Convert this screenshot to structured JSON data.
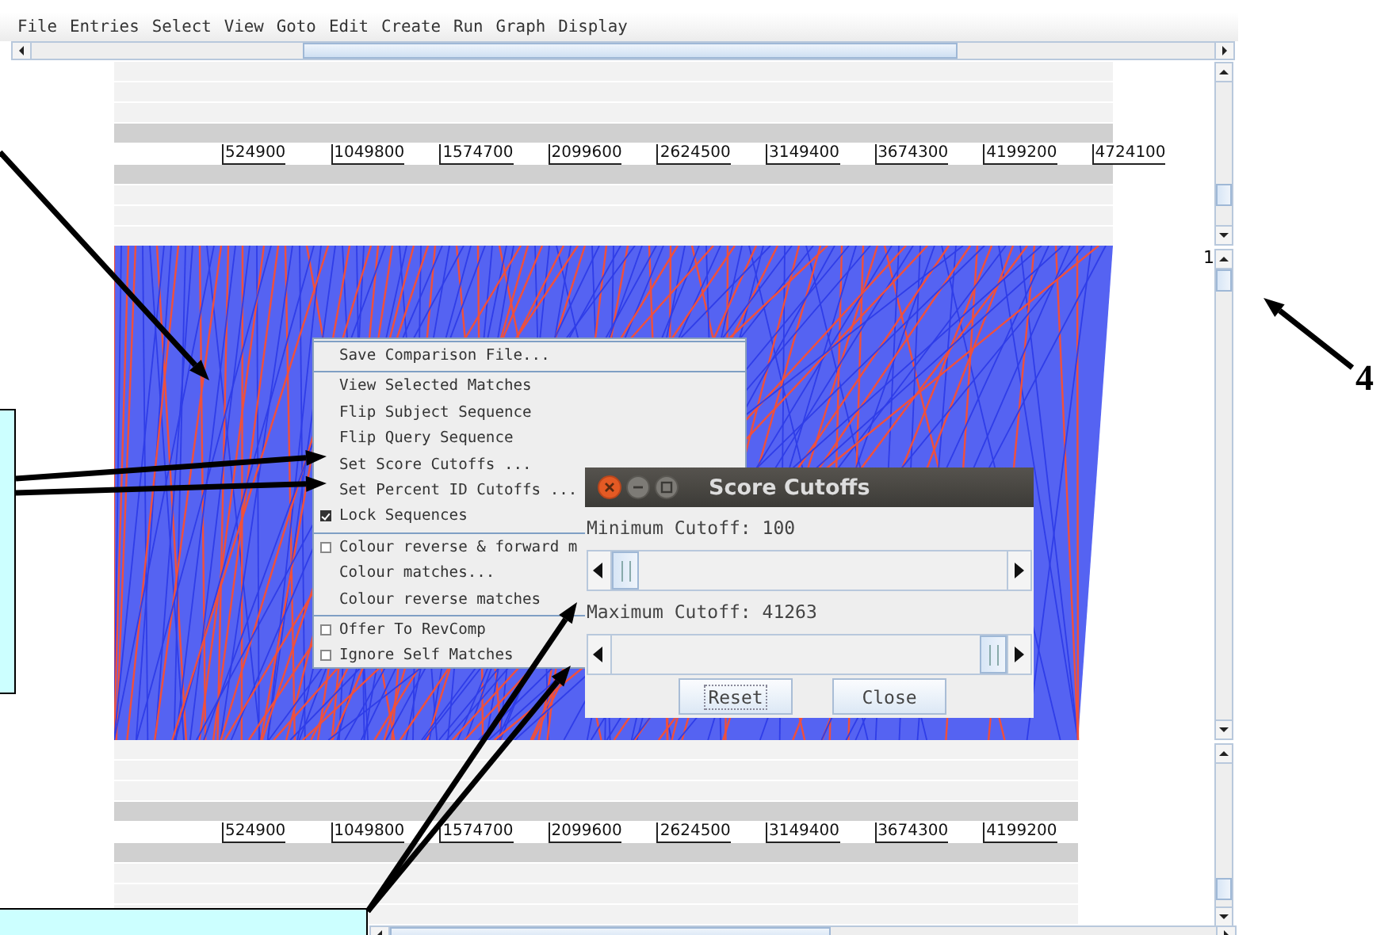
{
  "menubar": {
    "items": [
      "File",
      "Entries",
      "Select",
      "View",
      "Goto",
      "Edit",
      "Create",
      "Run",
      "Graph",
      "Display"
    ]
  },
  "top_ruler": {
    "ticks": [
      "524900",
      "1049800",
      "1574700",
      "2099600",
      "2624500",
      "3149400",
      "3674300",
      "4199200",
      "4724100"
    ]
  },
  "comparison_view": {
    "side_label": "1"
  },
  "bottom_ruler": {
    "ticks": [
      "524900",
      "1049800",
      "1574700",
      "2099600",
      "2624500",
      "3149400",
      "3674300",
      "4199200"
    ]
  },
  "popup_menu": {
    "groups": [
      [
        {
          "kind": "action",
          "label": "Save Comparison File..."
        }
      ],
      [
        {
          "kind": "action",
          "label": "View Selected Matches"
        },
        {
          "kind": "action",
          "label": "Flip Subject Sequence"
        },
        {
          "kind": "action",
          "label": "Flip Query Sequence"
        },
        {
          "kind": "action",
          "label": "Set Score Cutoffs ..."
        },
        {
          "kind": "action",
          "label": "Set Percent ID Cutoffs ..."
        },
        {
          "kind": "checkbox",
          "label": "Lock Sequences",
          "checked": true
        }
      ],
      [
        {
          "kind": "checkbox",
          "label": "Colour reverse & forward m",
          "checked": false
        },
        {
          "kind": "action",
          "label": "Colour matches..."
        },
        {
          "kind": "action",
          "label": "Colour reverse matches"
        }
      ],
      [
        {
          "kind": "checkbox",
          "label": "Offer To RevComp",
          "checked": false
        },
        {
          "kind": "checkbox",
          "label": "Ignore Self Matches",
          "checked": false
        }
      ]
    ]
  },
  "dialog": {
    "title": "Score Cutoffs",
    "sliders": [
      {
        "label": "Minimum Cutoff: 100",
        "level": 0
      },
      {
        "label": "Maximum Cutoff: 41263",
        "level": 1
      }
    ],
    "buttons": [
      {
        "label": "Reset",
        "focused": true
      },
      {
        "label": "Close",
        "focused": false
      }
    ]
  },
  "annotations": {
    "callout_number": "4"
  }
}
